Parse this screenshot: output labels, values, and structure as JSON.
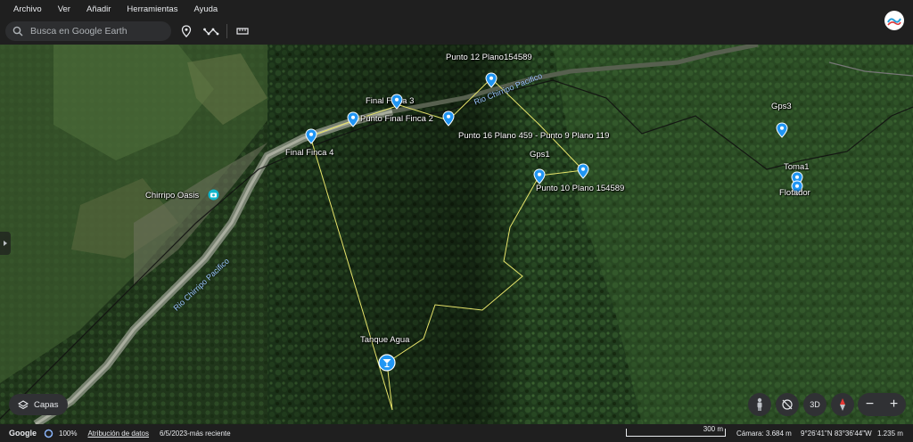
{
  "menu": [
    "Archivo",
    "Ver",
    "Añadir",
    "Herramientas",
    "Ayuda"
  ],
  "search": {
    "placeholder": "Busca en Google Earth"
  },
  "toolbar_icons": [
    "pin-icon",
    "path-icon",
    "ruler-icon"
  ],
  "map": {
    "places": {
      "punto12": "Punto 12 Plano154589",
      "final_finca_3": "Final Finca 3",
      "punto_final_finca_2": "Punto Final Finca 2",
      "punto16": "Punto 16 Plano 459 - Punto 9 Plano 119",
      "final_finca_4": "Final Finca 4",
      "gps1": "Gps1",
      "punto10": "Punto 10 Plano 154589",
      "gps3": "Gps3",
      "toma1": "Toma1",
      "flotador": "Flotador",
      "chirripo_oasis": "Chirripo Oasis",
      "tanque_agua": "Tanque Agua"
    },
    "rivers": {
      "upper": "Rio Chirripo Pacifico",
      "lower": "Rio Chirripo Pacifico"
    },
    "colors": {
      "pin": "#2196f3",
      "path": "#e6e36a",
      "river_label": "#9cc8ff"
    }
  },
  "controls": {
    "layers_label": "Capas",
    "mode_3d": "3D",
    "zoom_out": "−",
    "zoom_in": "+"
  },
  "status": {
    "brand": "Google",
    "zoom": "100%",
    "attribution": "Atribución de datos",
    "imagery_date": "6/5/2023-más reciente",
    "scale": "300 m",
    "camera": "Cámara: 3.684 m",
    "coords": "9°26'41\"N 83°36'44\"W",
    "elevation": "1.235 m"
  }
}
